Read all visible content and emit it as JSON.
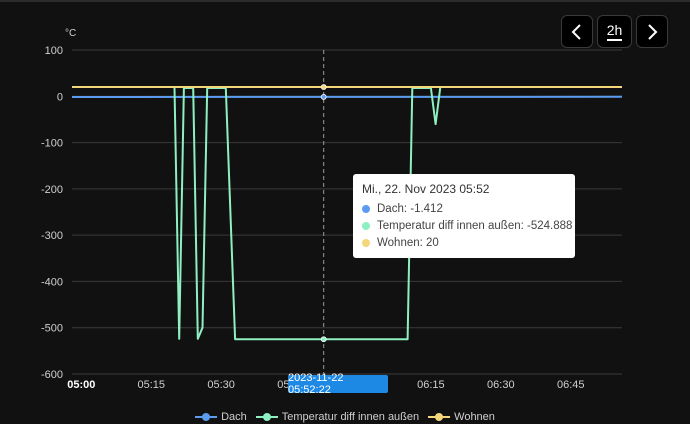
{
  "controls": {
    "prev_icon": "chevron-left-icon",
    "range_label": "2h",
    "next_icon": "chevron-right-icon"
  },
  "chart_data": {
    "type": "line",
    "ylabel": "°C",
    "ylim": [
      -600,
      100
    ],
    "yticks": [
      100,
      0,
      -100,
      -200,
      -300,
      -400,
      -500,
      -600
    ],
    "xlim": [
      "2023-11-22 04:58",
      "2023-11-22 06:56"
    ],
    "xticks": [
      {
        "label": "05:00",
        "time": "2023-11-22 05:00",
        "bold": true
      },
      {
        "label": "05:15",
        "time": "2023-11-22 05:15"
      },
      {
        "label": "05:30",
        "time": "2023-11-22 05:30"
      },
      {
        "label": "05:45",
        "time": "2023-11-22 05:45"
      },
      {
        "label": "06:00",
        "time": "2023-11-22 06:00"
      },
      {
        "label": "06:15",
        "time": "2023-11-22 06:15"
      },
      {
        "label": "06:30",
        "time": "2023-11-22 06:30"
      },
      {
        "label": "06:45",
        "time": "2023-11-22 06:45"
      }
    ],
    "grid": true,
    "legend_position": "bottom",
    "series": [
      {
        "name": "Dach",
        "color": "#5b9bf0",
        "points": [
          [
            "2023-11-22 04:58",
            -1.5
          ],
          [
            "2023-11-22 05:52",
            -1.412
          ],
          [
            "2023-11-22 06:56",
            -1.2
          ]
        ]
      },
      {
        "name": "Temperatur diff innen außen",
        "color": "#8ef0c0",
        "points": [
          [
            "2023-11-22 05:20",
            18
          ],
          [
            "2023-11-22 05:21",
            -524
          ],
          [
            "2023-11-22 05:22",
            18
          ],
          [
            "2023-11-22 05:24",
            18
          ],
          [
            "2023-11-22 05:25",
            -524
          ],
          [
            "2023-11-22 05:26",
            -500
          ],
          [
            "2023-11-22 05:27",
            18
          ],
          [
            "2023-11-22 05:31",
            18
          ],
          [
            "2023-11-22 05:33",
            -524.888
          ],
          [
            "2023-11-22 05:52",
            -524.888
          ],
          [
            "2023-11-22 06:10",
            -524.888
          ],
          [
            "2023-11-22 06:11",
            18
          ],
          [
            "2023-11-22 06:15",
            18
          ],
          [
            "2023-11-22 06:16",
            -60
          ],
          [
            "2023-11-22 06:17",
            18
          ]
        ]
      },
      {
        "name": "Wohnen",
        "color": "#f3d77a",
        "points": [
          [
            "2023-11-22 04:58",
            20
          ],
          [
            "2023-11-22 05:52",
            20
          ],
          [
            "2023-11-22 06:56",
            20
          ]
        ]
      }
    ],
    "cursor": {
      "time": "2023-11-22 05:52",
      "label": "2023-11-22 05:52:22"
    }
  },
  "tooltip": {
    "title": "Mi., 22. Nov 2023 05:52",
    "rows": [
      {
        "text": "Dach: -1.412",
        "color": "#5b9bf0"
      },
      {
        "text": "Temperatur diff innen außen: -524.888",
        "color": "#8ef0c0"
      },
      {
        "text": "Wohnen: 20",
        "color": "#f3d77a"
      }
    ]
  }
}
